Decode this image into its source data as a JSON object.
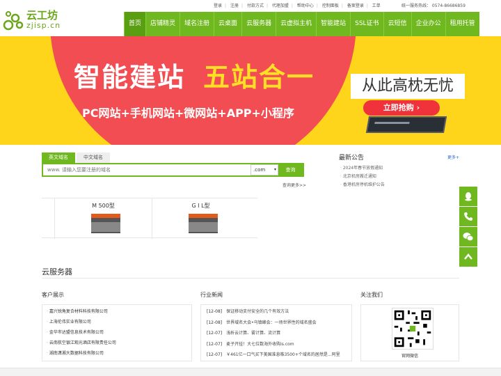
{
  "header": {
    "logo_name": "云工坊",
    "logo_domain": "zjisp.cn",
    "toplinks": [
      "登录",
      "注册",
      "付款方式",
      "代理加盟",
      "帮助中心",
      "控制面板",
      "备案登录",
      "工单"
    ],
    "hotline": "统一服务热线： 0574-86686859"
  },
  "nav": [
    "首页",
    "店铺精灵",
    "域名注册",
    "云桌面",
    "云服务器",
    "云虚拟主机",
    "智能建站",
    "SSL证书",
    "云短信",
    "企业办公",
    "租用托管"
  ],
  "banner": {
    "title_part1": "智能建站",
    "title_part2": "五站合一",
    "subtitle": "PC网站+手机网站+微网站+APP+小程序",
    "slogan": "从此高枕无忧",
    "cta": "立即抢购"
  },
  "domain_search": {
    "tabs": [
      "英文域名",
      "中文域名"
    ],
    "placeholder": "www. 请输入您要注册的域名",
    "suffix": ".com",
    "button": "查询",
    "more": "查询更多>>"
  },
  "notice": {
    "title": "最新公告",
    "more": "更多+",
    "items": [
      "2024年春节放假通知",
      "北京机房搬迁通知",
      "香港机房停机维护公告"
    ]
  },
  "products": [
    {
      "name": "M 500型",
      "image_text": "Hosting"
    },
    {
      "name": "G I L型",
      "image_text": "Hosting"
    }
  ],
  "section": {
    "title": "云服务器"
  },
  "clients": {
    "title": "客户展示",
    "items": [
      "嘉兴锐角复合材料科技有限公司",
      "上海伦伟实业有限公司",
      "金华市达盟信息技术有限公司",
      "云南航空银江观光酒店有限责任公司",
      "湖南潇湘大数据科技有限公司"
    ]
  },
  "news": {
    "title": "行业新闻",
    "items": [
      {
        "date": "[12-08]",
        "text": "保证移动支付安全的几个有效方法"
      },
      {
        "date": "[12-08]",
        "text": "世界域名大会•乌镇峰会：一场世界性的域名盛会"
      },
      {
        "date": "[12-07]",
        "text": "浅析云计算、雾计算、流计算"
      },
      {
        "date": "[12-07]",
        "text": "麦子开挂！大七位数海外收购is.com"
      },
      {
        "date": "[12-07]",
        "text": "￥461亿一口气买下美国准息株3500+个域名的居然是...阿里"
      }
    ]
  },
  "contact": {
    "title": "关注我们",
    "qr_label": "官网微信"
  },
  "floating": [
    "qq-icon",
    "phone-icon",
    "wechat-icon",
    "back-to-top-icon"
  ],
  "colors": {
    "brand": "#6fb81f",
    "banner_bg": "#ffd51c",
    "banner_shape": "#f24d52",
    "cta": "#f0323a"
  }
}
